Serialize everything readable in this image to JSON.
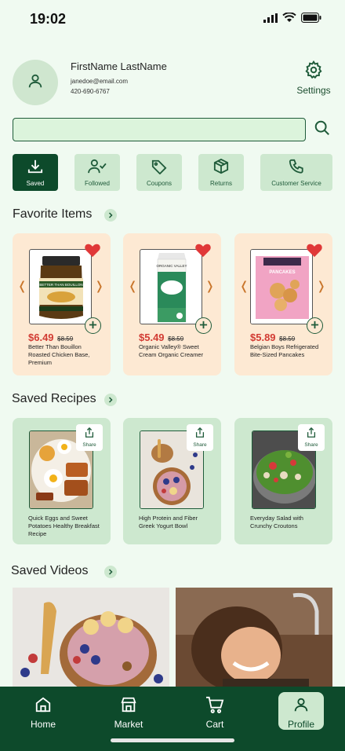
{
  "status_bar": {
    "time": "19:02"
  },
  "profile": {
    "name": "FirstName LastName",
    "email": "janedoe@email.com",
    "phone": "420-690-6767",
    "settings_label": "Settings"
  },
  "search": {
    "value": "",
    "placeholder": ""
  },
  "quick_actions": [
    {
      "label": "Saved",
      "icon": "download-icon",
      "active": true
    },
    {
      "label": "Followed",
      "icon": "user-check-icon",
      "active": false
    },
    {
      "label": "Coupons",
      "icon": "tag-icon",
      "active": false
    },
    {
      "label": "Returns",
      "icon": "box-icon",
      "active": false
    },
    {
      "label": "Customer Service",
      "icon": "phone-icon",
      "active": false
    }
  ],
  "favorites": {
    "title": "Favorite Items",
    "items": [
      {
        "price": "$6.49",
        "old_price": "$8.59",
        "name": "Better Than Bouillon Roasted Chicken Base, Premium",
        "product_text": "BETTER THAN BOUILLON"
      },
      {
        "price": "$5.49",
        "old_price": "$8.59",
        "name": "Organic Valley® Sweet Cream Organic Creamer",
        "product_text": "ORGANIC VALLEY"
      },
      {
        "price": "$5.89",
        "old_price": "$8.59",
        "name": "Belgian Boys Refrigerated Bite-Sized Pancakes",
        "product_text": "PANCAKES"
      }
    ]
  },
  "recipes": {
    "title": "Saved Recipes",
    "share_label": "Share",
    "items": [
      {
        "name": "Quick Eggs and Sweet Potatoes Healthy Breakfast Recipe"
      },
      {
        "name": "High Protein and Fiber Greek Yogurt Bowl"
      },
      {
        "name": "Everyday Salad with Crunchy Croutons"
      }
    ]
  },
  "videos": {
    "title": "Saved Videos"
  },
  "nav": {
    "items": [
      {
        "label": "Home",
        "icon": "home-icon",
        "active": false
      },
      {
        "label": "Market",
        "icon": "store-icon",
        "active": false
      },
      {
        "label": "Cart",
        "icon": "cart-icon",
        "active": false
      },
      {
        "label": "Profile",
        "icon": "user-icon",
        "active": true
      }
    ]
  },
  "colors": {
    "primary": "#0d4a2b",
    "accent_light": "#cde8cf",
    "background": "#f0faf1",
    "price": "#d23b33",
    "card_peach": "#fde9d3"
  }
}
